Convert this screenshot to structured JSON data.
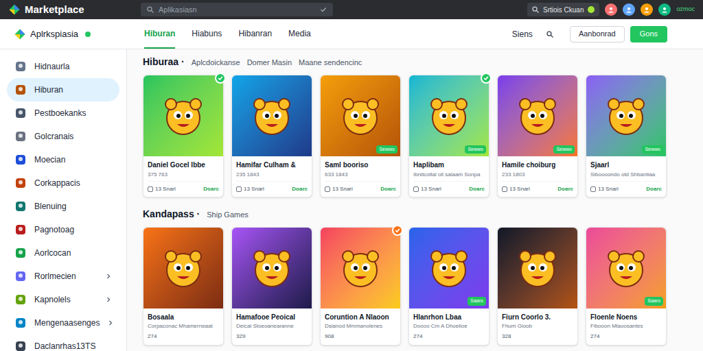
{
  "app": {
    "title": "Marketplace"
  },
  "top_search": {
    "placeholder": "Aplikasiasn"
  },
  "top_right": {
    "search_text": "Srtiois Ckuan",
    "status": "ozmoc"
  },
  "store": {
    "name": "Aplrkspiasia"
  },
  "tabs": [
    {
      "label": "Hiburan",
      "selected": true
    },
    {
      "label": "Hiabuns",
      "selected": false
    },
    {
      "label": "Hibanran",
      "selected": false
    },
    {
      "label": "Media",
      "selected": false
    }
  ],
  "nav_right": {
    "signin": "Siens",
    "outline_button": "Aanbonrad",
    "primary_button": "Gons"
  },
  "sidebar": {
    "items": [
      {
        "label": "Hidnaurla",
        "selected": false,
        "expandable": false
      },
      {
        "label": "Hiburan",
        "selected": true,
        "expandable": false
      },
      {
        "label": "Pestboekanks",
        "selected": false,
        "expandable": false
      },
      {
        "label": "Golcranais",
        "selected": false,
        "expandable": false
      },
      {
        "label": "Moecian",
        "selected": false,
        "expandable": false
      },
      {
        "label": "Corkappacis",
        "selected": false,
        "expandable": false
      },
      {
        "label": "Blenuing",
        "selected": false,
        "expandable": false
      },
      {
        "label": "Pagnotoag",
        "selected": false,
        "expandable": false
      },
      {
        "label": "Aorlcocan",
        "selected": false,
        "expandable": false
      },
      {
        "label": "Rorlmecien",
        "selected": false,
        "expandable": true
      },
      {
        "label": "Kapnolels",
        "selected": false,
        "expandable": true
      },
      {
        "label": "Mengenaasenges",
        "selected": false,
        "expandable": true
      },
      {
        "label": "Daclanrhas13TS",
        "selected": false,
        "expandable": false
      }
    ]
  },
  "sections": [
    {
      "title": "Hiburaa ·",
      "subtitles": [
        "Aplcdoickanse",
        "Domer Masin",
        "Maane sendencinc"
      ],
      "cards": [
        {
          "title": "Daniel Gocel Ibbe",
          "subtitle": "375 763",
          "meta": "13 Snarl",
          "action": "Doarc",
          "badge": true,
          "badge_color": "#22c55e",
          "tag": ""
        },
        {
          "title": "Hamifar Culham &",
          "subtitle": "235 1843",
          "meta": "13 Snarl",
          "action": "Doarc",
          "badge": false,
          "badge_color": "",
          "tag": ""
        },
        {
          "title": "Saml booriso",
          "subtitle": "633 1843",
          "meta": "13 Snarl",
          "action": "Doarc",
          "badge": false,
          "badge_color": "",
          "tag": "Sewwo"
        },
        {
          "title": "Haplibam",
          "subtitle": "Ibnitcoltal oll salaam Sonpa",
          "meta": "13 Snarl",
          "action": "Doarc",
          "badge": true,
          "badge_color": "#22c55e",
          "tag": "Sewwo"
        },
        {
          "title": "Hamile choiburg",
          "subtitle": "233 1803",
          "meta": "13 Snarl",
          "action": "Doarc",
          "badge": false,
          "badge_color": "",
          "tag": "Sewwo"
        },
        {
          "title": "Sjaarl",
          "subtitle": "Siboooondo otd Shbantiaa",
          "meta": "13 Snarl",
          "action": "Doarc",
          "badge": false,
          "badge_color": "",
          "tag": "Sewwo"
        }
      ]
    },
    {
      "title": "Kandapass ·",
      "subtitles": [
        "Ship Games"
      ],
      "cards": [
        {
          "title": "Bosaala",
          "subtitle": "Corpaconac Mhamerneaat",
          "meta": "274",
          "action": "",
          "badge": false,
          "badge_color": "",
          "tag": ""
        },
        {
          "title": "Hamafooe Peoical",
          "subtitle": "Deical Stoeoanearanne",
          "meta": "329",
          "action": "",
          "badge": false,
          "badge_color": "",
          "tag": ""
        },
        {
          "title": "Coruntion A Nlaoon",
          "subtitle": "Dsianod Mmmanolenes",
          "meta": "908",
          "action": "",
          "badge": true,
          "badge_color": "#f97316",
          "tag": ""
        },
        {
          "title": "Hlanrhon Lbaa",
          "subtitle": "Doooo Cm A Dhoelioe",
          "meta": "274",
          "action": "",
          "badge": false,
          "badge_color": "",
          "tag": "Saaro"
        },
        {
          "title": "Fiurn Coorlo 3.",
          "subtitle": "Fhum Gloob",
          "meta": "328",
          "action": "",
          "badge": false,
          "badge_color": "",
          "tag": ""
        },
        {
          "title": "Floenle Noens",
          "subtitle": "Fibooon Mlaoosantes",
          "meta": "274",
          "action": "",
          "badge": false,
          "badge_color": "",
          "tag": "Saaro"
        }
      ]
    }
  ]
}
